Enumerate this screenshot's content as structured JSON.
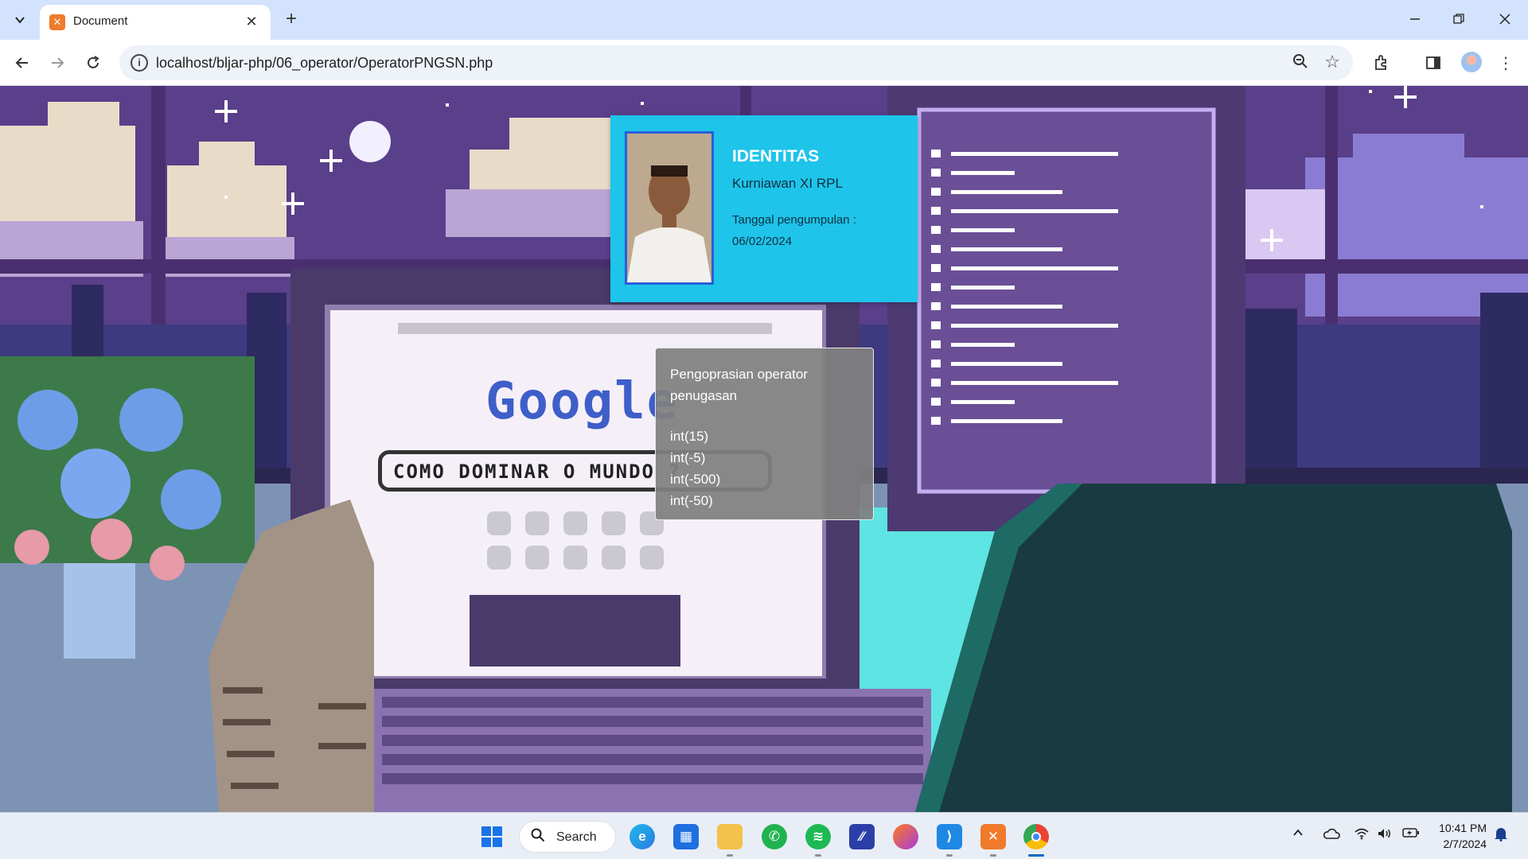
{
  "browser": {
    "tab_title": "Document",
    "url": "localhost/bljar-php/06_operator/OperatorPNGSN.php",
    "favicon_icon": "xampp-icon"
  },
  "page": {
    "identitas": {
      "heading": "IDENTITAS",
      "name": "Kurniawan XI RPL",
      "date_label": "Tanggal pengumpulan :",
      "date_value": "06/02/2024"
    },
    "operator": {
      "heading": "Pengoprasian operator penugasan",
      "results": [
        "int(15)",
        "int(-5)",
        "int(-500)",
        "int(-50)"
      ]
    },
    "background_text": {
      "logo": "Google",
      "search_text": "COMO DOMINAR O MUNDO ?"
    }
  },
  "taskbar": {
    "search_label": "Search",
    "time": "10:41 PM",
    "date": "2/7/2024"
  }
}
